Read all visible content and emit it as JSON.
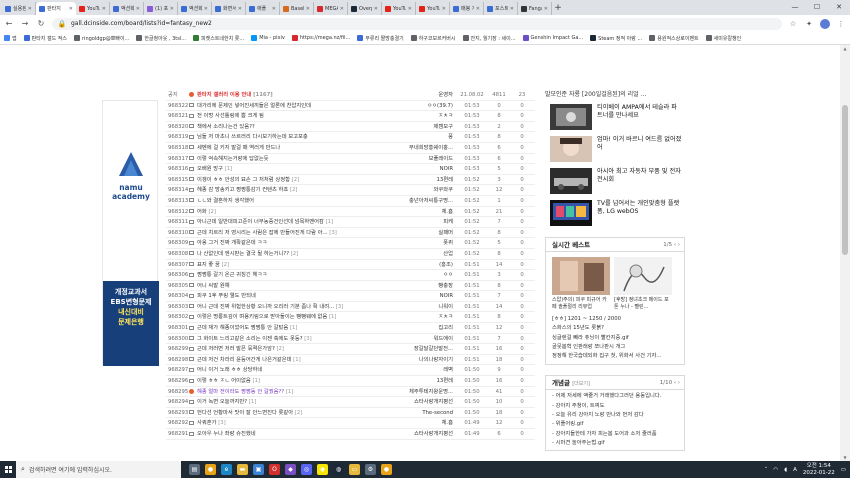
{
  "browser": {
    "tabs": [
      {
        "title": "실용된",
        "color": "#3b6cd6"
      },
      {
        "title": "판타지",
        "color": "#3b6cd6",
        "active": true
      },
      {
        "title": "YouTube",
        "color": "#e62117"
      },
      {
        "title": "액션화",
        "color": "#3b6cd6"
      },
      {
        "title": "(1) 포인",
        "color": "#8a5bd6"
      },
      {
        "title": "액션화",
        "color": "#3b6cd6"
      },
      {
        "title": "화면서",
        "color": "#3b6cd6"
      },
      {
        "title": "애플",
        "color": "#3b6cd6"
      },
      {
        "title": "Baselli",
        "color": "#d86a1e"
      },
      {
        "title": "MEGA",
        "color": "#d9272e"
      },
      {
        "title": "Overp",
        "color": "#1b2838"
      },
      {
        "title": "YouTub",
        "color": "#e62117"
      },
      {
        "title": "YouTul",
        "color": "#e62117"
      },
      {
        "title": "매봉 가",
        "color": "#3b6cd6"
      },
      {
        "title": "포스트",
        "color": "#3b6cd6"
      },
      {
        "title": "Fangal",
        "color": "#333"
      }
    ],
    "new_tab": "+",
    "minimize": "—",
    "maximize": "☐",
    "close": "✕",
    "url": "gall.dcinside.com/board/lists?id=fantasy_new2",
    "bookmarks": [
      {
        "label": "앱",
        "color": "#4285f4"
      },
      {
        "label": "판타지 갤드 적스",
        "color": "#3b6cd6"
      },
      {
        "label": "ringoldgp@뽀빠이...",
        "color": "#5f6368"
      },
      {
        "label": "한글청아웃 , 3tsl...",
        "color": "#5f6368"
      },
      {
        "label": "피켓스트네한치 롯...",
        "color": "#2e7d32"
      },
      {
        "label": "Mia - pixiv",
        "color": "#0096fa"
      },
      {
        "label": "https://mega.nz/fil...",
        "color": "#d9272e"
      },
      {
        "label": "부류리 짤방충결기",
        "color": "#3b6cd6"
      },
      {
        "label": "하구코보르커버시",
        "color": "#5f6368"
      },
      {
        "label": "잔지, 월기장 : 세이...",
        "color": "#5f6368"
      },
      {
        "label": "Genshin Impact Ga...",
        "color": "#6a4fc9"
      },
      {
        "label": "Steam 정적 아랑 ...",
        "color": "#1b2838"
      },
      {
        "label": "용원적스상로이벤트",
        "color": "#5f6368"
      },
      {
        "label": "새미유칼챙인",
        "color": "#5f6368"
      }
    ]
  },
  "ad": {
    "brand_line1": "namu",
    "brand_line2": "academy",
    "lines": [
      "개정교과서",
      "EBS변형문제",
      "내신대비",
      "문제은행"
    ]
  },
  "posts": [
    {
      "no": "공지",
      "title": "판타지 갤러리 이용 안내",
      "comments": "[1167]",
      "writer": "운영자",
      "date": "21.08.02",
      "views": "4811",
      "recs": "23",
      "type": "notice"
    },
    {
      "no": "968322",
      "title": "대가리에 문제인 넣어진세끼들은 얼론에 찬압지인데",
      "comments": "",
      "writer": "ㅇㅇ(39.7)",
      "date": "01:53",
      "views": "0",
      "recs": "0"
    },
    {
      "no": "968321",
      "title": "전 이멍 사선톨링에 쁨 크게 됨",
      "comments": "",
      "writer": "ㅈㅊㅋ",
      "date": "01:53",
      "views": "8",
      "recs": "0"
    },
    {
      "no": "968320",
      "title": "책에서 소리나는건 있음??",
      "comments": "",
      "writer": "제캠모구",
      "date": "01:53",
      "views": "2",
      "recs": "0"
    },
    {
      "no": "968319",
      "title": "님들 저 마초니 쓰르러리 다시보기하는데 보고포충",
      "comments": "",
      "writer": "풍",
      "date": "01:53",
      "views": "8",
      "recs": "0"
    },
    {
      "no": "968318",
      "title": "세벤에 걸 키지 말걸 패 역러게 만드나",
      "comments": "",
      "writer": "부네회망홍쉐이훙...",
      "date": "01:53",
      "views": "6",
      "recs": "0"
    },
    {
      "no": "968317",
      "title": "이렇 억속해지는거랑에 답없는듯",
      "comments": "",
      "writer": "보풀레이드",
      "date": "01:53",
      "views": "6",
      "recs": "0"
    },
    {
      "no": "968316",
      "title": "오배원 망구",
      "comments": "[1]",
      "writer": "NOIR",
      "date": "01:53",
      "views": "5",
      "recs": "0"
    },
    {
      "no": "968315",
      "title": "이갱이 ㅎㅎ 안성의 묘손 그 저처럼 상정함",
      "comments": "[2]",
      "writer": "13편레",
      "date": "01:52",
      "views": "3",
      "recs": "0"
    },
    {
      "no": "968314",
      "title": "헤종 감 방송키고 쩡쩡통감기 컨텐츠 하죠",
      "comments": "[2]",
      "writer": "와쿠와쿠",
      "date": "01:52",
      "views": "12",
      "recs": "0"
    },
    {
      "no": "968313",
      "title": "ㄴㄴ와 결혼하지 생각했어",
      "comments": "",
      "writer": "충넌아저씨통구명...",
      "date": "01:52",
      "views": "1",
      "recs": "0"
    },
    {
      "no": "968312",
      "title": "어화",
      "comments": "[2]",
      "writer": "체.흠",
      "date": "01:52",
      "views": "21",
      "recs": "0"
    },
    {
      "no": "968311",
      "title": "아니근데 일반대피고준이 너무농중건인선데 넘목하멘어캄",
      "comments": "[1]",
      "writer": "피케",
      "date": "01:52",
      "views": "7",
      "recs": "0"
    },
    {
      "no": "968310",
      "title": "근데 치르리 저 영시리는 사람은 잡에 만들어진게 다람 아...",
      "comments": "[3]",
      "writer": "실패머",
      "date": "01:52",
      "views": "8",
      "recs": "0"
    },
    {
      "no": "968309",
      "title": "아옹 그거 진짜 개확같은데 ㅋㅋ",
      "comments": "",
      "writer": "폿퀴",
      "date": "01:52",
      "views": "5",
      "recs": "0"
    },
    {
      "no": "968308",
      "title": "나 산없인데 엔시판는 결국 될 하는거니??",
      "comments": "[2]",
      "writer": "산업",
      "date": "01:52",
      "views": "8",
      "recs": "0"
    },
    {
      "no": "968307",
      "title": "표지 좋 꿈",
      "comments": "[2]",
      "writer": "(홍조)",
      "date": "01:51",
      "views": "14",
      "recs": "0"
    },
    {
      "no": "968306",
      "title": "쩡쩡통 갈기 온근 귀칭긴 헤ㅋㅋ",
      "comments": "",
      "writer": "ㅇㅇ",
      "date": "01:51",
      "views": "3",
      "recs": "0"
    },
    {
      "no": "968305",
      "title": "어니 씨발 원예",
      "comments": "",
      "writer": "빵충장",
      "date": "01:51",
      "views": "8",
      "recs": "0"
    },
    {
      "no": "968304",
      "title": "피쿠 1후 푸링 웰도 만되네",
      "comments": "",
      "writer": "NOIR",
      "date": "01:51",
      "views": "7",
      "recs": "0"
    },
    {
      "no": "968303",
      "title": "어니 근데 진짜 위험한상황 오니까 오리러 기분 좀나 확 내려...",
      "comments": "[3]",
      "writer": "니워이",
      "date": "01:51",
      "views": "14",
      "recs": "0"
    },
    {
      "no": "968302",
      "title": "이렇은 명롱트깊이 며용키링으로 받아둘이는 뻥뻥웨에 없음",
      "comments": "[1]",
      "writer": "ㅈㅊㅋ",
      "date": "01:51",
      "views": "8",
      "recs": "0"
    },
    {
      "no": "968301",
      "title": "근데 재가 해종이었어도 쩡쩡통 안 갈텄음",
      "comments": "[1]",
      "writer": "집고리",
      "date": "01:51",
      "views": "12",
      "recs": "0"
    },
    {
      "no": "968300",
      "title": "그 화이트 느리고같은 소리는 이젠 축에도 못등?",
      "comments": "[3]",
      "writer": "워드에이",
      "date": "01:51",
      "views": "7",
      "recs": "0"
    },
    {
      "no": "968299",
      "title": "근데 저러면 저러 발픈 묶젹은가암?",
      "comments": "[2]",
      "writer": "장갈달갈던말전...",
      "date": "01:51",
      "views": "16",
      "recs": "0"
    },
    {
      "no": "968298",
      "title": "근데 저건 차라리 윤등어간게 나은거같은데",
      "comments": "[1]",
      "writer": "나의나랑자이기",
      "date": "01:51",
      "views": "18",
      "recs": "0"
    },
    {
      "no": "968297",
      "title": "어니 이거 노래 ㅎㅎ 상당하네",
      "comments": "",
      "writer": "레벽",
      "date": "01:50",
      "views": "9",
      "recs": "0"
    },
    {
      "no": "968296",
      "title": "이렇 ㅎㅎ ㅈㄴ 어이없음",
      "comments": "[1]",
      "writer": "13편레",
      "date": "01:50",
      "views": "16",
      "recs": "0"
    },
    {
      "no": "968295",
      "title": "해종 얼마 전이라도 쩡쩡동 안 갈꿨음??",
      "comments": "[1]",
      "writer": "체주투테지왕운명...",
      "date": "01:50",
      "views": "41",
      "recs": "0",
      "type": "hot"
    },
    {
      "no": "968294",
      "title": "이거 녹변 오늘까지만?",
      "comments": "[1]",
      "writer": "쇼타사랑개지평선",
      "date": "01:50",
      "views": "10",
      "recs": "0"
    },
    {
      "no": "968293",
      "title": "헌다선 언황마서 맛이 잘 안느면진다 롯같아",
      "comments": "[2]",
      "writer": "The-second",
      "date": "01:50",
      "views": "18",
      "recs": "0"
    },
    {
      "no": "968292",
      "title": "사쿼혼가",
      "comments": "[3]",
      "writer": "체.흠",
      "date": "01:49",
      "views": "12",
      "recs": "0"
    },
    {
      "no": "968291",
      "title": "오아우 누나 좌랑 슈진했네",
      "comments": "",
      "writer": "쇼타사랑개지평선",
      "date": "01:49",
      "views": "6",
      "recs": "0"
    }
  ],
  "sidebar": {
    "top_title": "말모인준 자룡 [200일걸음된]의 리얼 ...",
    "news": [
      {
        "text": "티이베이 AMPA에서 테슬라 파트너를 만나세요"
      },
      {
        "text": "엄마! 이거 바르니 여드름 없어졌어"
      },
      {
        "text": "아시아 최고 자동차 부품 및 전자 전시회"
      },
      {
        "text": "TV를 넘어서는 개인맞춤형 플랫폼, LG webOS"
      }
    ],
    "realtime_best": {
      "title": "실시간 베스트",
      "pager": "1/5",
      "captions": [
        "스압)주의) 피쿠 피규어 카페 솔플절리 리뷰업",
        "[후방] 정녀초크 메이드 포톤 누나 - 펠린..."
      ],
      "items": [
        "[ㅎㅎ] 1201 ~ 1250 / 2000",
        "스화스의 15년도 롯붉?",
        "싱글렌걸 빼라 츄닝이 빨칸지중.gif",
        "골뭇봄혁 인판래랑 쪼나판시 개그",
        "정정해 한국습데되화 집구 첫, 위화서 사건 기자..."
      ]
    },
    "concept": {
      "title": "개념글",
      "title_suffix": "[더보기]",
      "pager": "1/10",
      "items": [
        "- 어제 저세에 액줄거 거래했다그러던 용동입니다.",
        "- 강아지 주청이, 트찌도",
        "- 오늘 유리 강아지 노랑 만나와 먼저 감다",
        "- 위플어링.gif",
        "- 강아지들한테 가자 피는봄 도어과 소저 줄러품",
        "- 시마견 놀아주는법.gif"
      ]
    }
  },
  "taskbar": {
    "search_placeholder": "검색하려면 여기에 입력하십시오.",
    "time": "오전 1:54",
    "date": "2022-01-22",
    "ime": "A",
    "apps": [
      {
        "name": "task-view-icon",
        "color": "#5a6b7d",
        "glyph": "▤"
      },
      {
        "name": "chrome-icon",
        "color": "#e8a317",
        "glyph": "●"
      },
      {
        "name": "edge-icon",
        "color": "#1e88c7",
        "glyph": "e"
      },
      {
        "name": "explorer-icon",
        "color": "#e5b93c",
        "glyph": "▬"
      },
      {
        "name": "store-icon",
        "color": "#3b82d6",
        "glyph": "▣"
      },
      {
        "name": "opera-icon",
        "color": "#d32f2f",
        "glyph": "O"
      },
      {
        "name": "nox-icon",
        "color": "#7b4fc4",
        "glyph": "◆"
      },
      {
        "name": "discord-icon",
        "color": "#5865f2",
        "glyph": "◎"
      },
      {
        "name": "kakao-icon",
        "color": "#f7e600",
        "glyph": "◉"
      },
      {
        "name": "steam-icon",
        "color": "#1b2838",
        "glyph": "◍"
      },
      {
        "name": "folder-icon",
        "color": "#e5b93c",
        "glyph": "▭"
      },
      {
        "name": "settings-icon",
        "color": "#5a6b7d",
        "glyph": "⚙"
      },
      {
        "name": "chrome-icon-2",
        "color": "#e8a317",
        "glyph": "●"
      }
    ]
  }
}
